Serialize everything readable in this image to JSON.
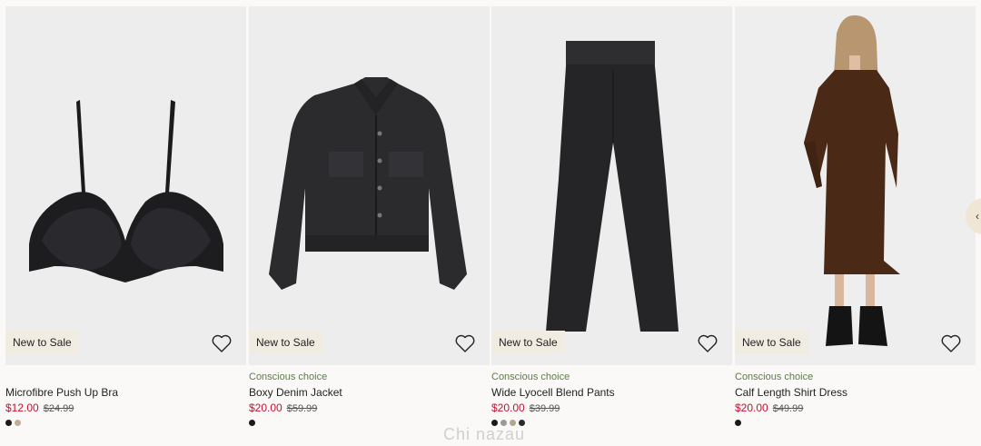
{
  "products": [
    {
      "badge": "New to Sale",
      "tag": "",
      "name": "Microfibre Push Up Bra",
      "sale_price": "$12.00",
      "original_price": "$24.99",
      "swatches": [
        "#1a1a1a",
        "#bfae98"
      ]
    },
    {
      "badge": "New to Sale",
      "tag": "Conscious choice",
      "name": "Boxy Denim Jacket",
      "sale_price": "$20.00",
      "original_price": "$59.99",
      "swatches": [
        "#1a1a1a"
      ]
    },
    {
      "badge": "New to Sale",
      "tag": "Conscious choice",
      "name": "Wide Lyocell Blend Pants",
      "sale_price": "$20.00",
      "original_price": "$39.99",
      "swatches": [
        "#1a1a1a",
        "#9a9a9a",
        "#b7a48c",
        "#2a2a2a"
      ]
    },
    {
      "badge": "New to Sale",
      "tag": "Conscious choice",
      "name": "Calf Length Shirt Dress",
      "sale_price": "$20.00",
      "original_price": "$49.99",
      "swatches": [
        "#1a1a1a"
      ]
    }
  ],
  "watermark": "Chi nazau",
  "colors": {
    "sale": "#c8102e",
    "conscious": "#5e7a4a",
    "badge_bg": "#f1ece2"
  }
}
